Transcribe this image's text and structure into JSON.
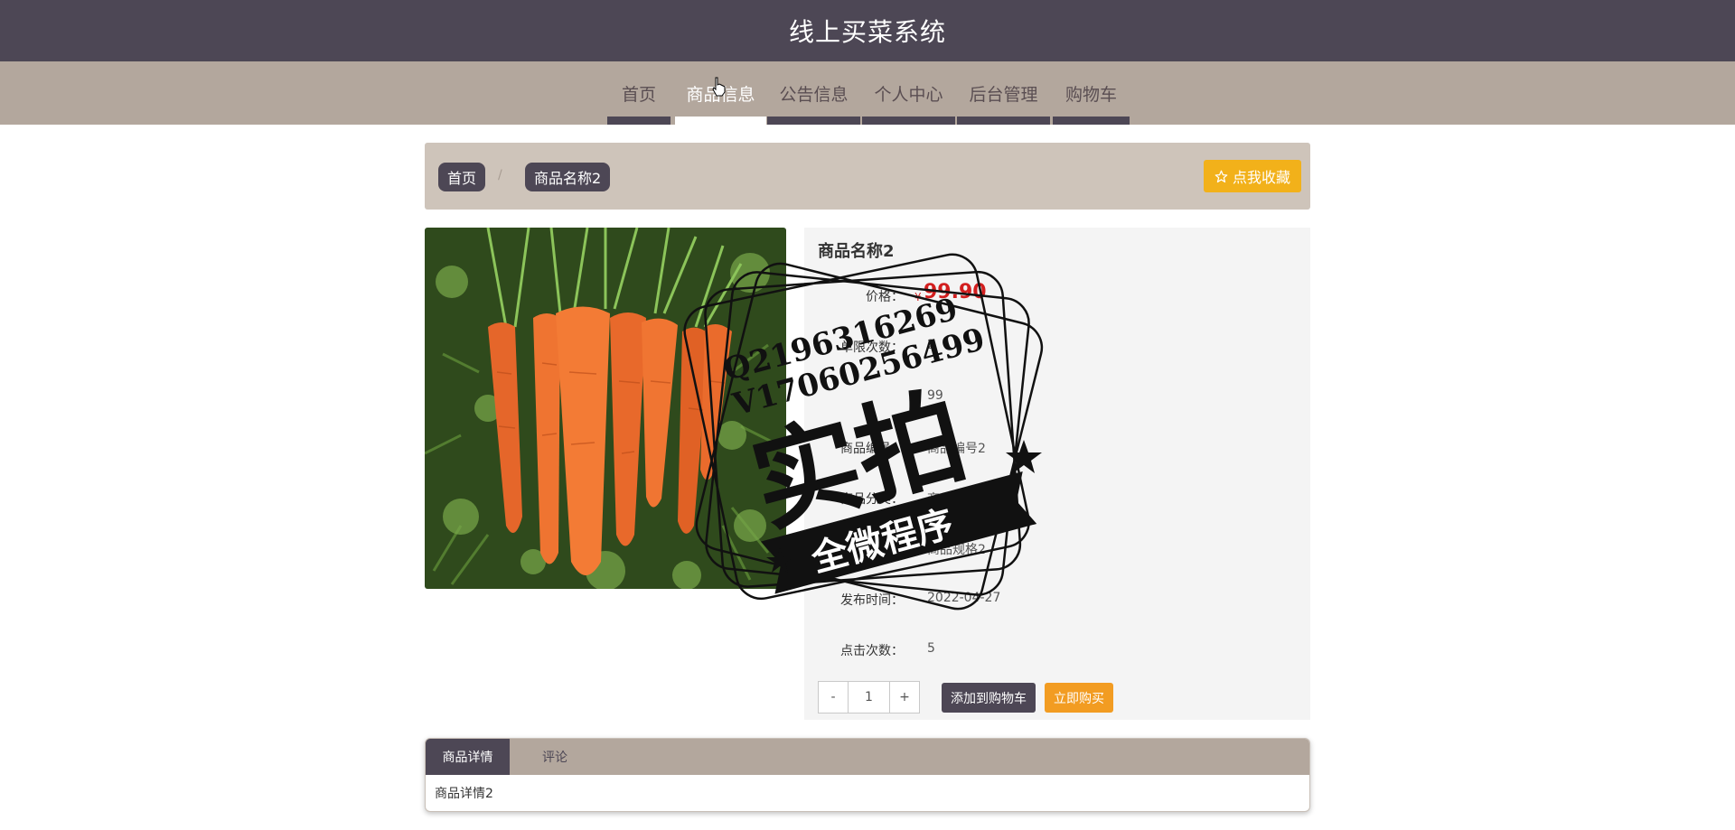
{
  "header": {
    "title": "线上买菜系统"
  },
  "nav": {
    "items": [
      {
        "label": "首页"
      },
      {
        "label": "商品信息"
      },
      {
        "label": "公告信息"
      },
      {
        "label": "个人中心"
      },
      {
        "label": "后台管理"
      },
      {
        "label": "购物车"
      }
    ],
    "active": "商品信息"
  },
  "breadcrumb": {
    "home": "首页",
    "separator": "/",
    "current": "商品名称2"
  },
  "favorite_button": {
    "label": "点我收藏",
    "icon": "star-outline-icon"
  },
  "product": {
    "name": "商品名称2",
    "image": "carrots-photo",
    "price_currency": "¥",
    "price_value": "99.90",
    "fields": [
      {
        "label": "价格：",
        "value": ""
      },
      {
        "label": "单限次数：",
        "value": "2"
      },
      {
        "label": "",
        "value": "99"
      },
      {
        "label": "商品编号：",
        "value": "商品编号2"
      },
      {
        "label": "商品分类：",
        "value": "商品分类2"
      },
      {
        "label": "商品规格：",
        "value": "商品规格2"
      },
      {
        "label": "发布时间：",
        "value": "2022-04-27"
      },
      {
        "label": "点击次数：",
        "value": "5"
      }
    ]
  },
  "quantity": {
    "minus": "-",
    "value": "1",
    "plus": "+"
  },
  "actions": {
    "add_to_cart": "添加到购物车",
    "buy_now": "立即购买"
  },
  "tabs": [
    {
      "label": "商品详情"
    },
    {
      "label": "评论"
    }
  ],
  "detail_text": "商品详情2",
  "watermark": {
    "line1": "Q2196316269",
    "line2": "V17060256499",
    "big": "实拍",
    "ribbon": "全微程序"
  },
  "colors": {
    "header_bg": "#4d4755",
    "nav_bg": "#b3a79d",
    "crumb_bg": "#cec4ba",
    "favorite": "#f2b11a",
    "buy": "#f29c22",
    "price": "#d21f1f"
  }
}
